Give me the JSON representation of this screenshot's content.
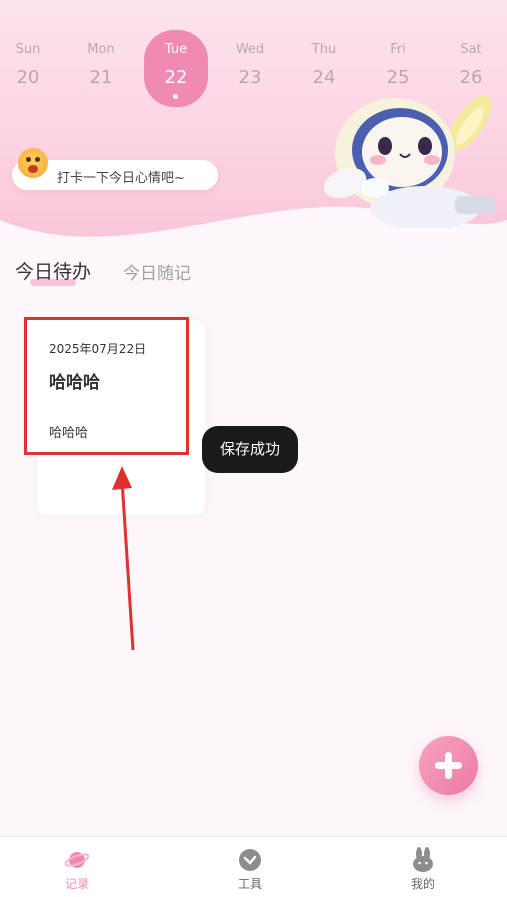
{
  "week": [
    {
      "name": "Sun",
      "num": "20"
    },
    {
      "name": "Mon",
      "num": "21"
    },
    {
      "name": "Tue",
      "num": "22",
      "selected": true
    },
    {
      "name": "Wed",
      "num": "23"
    },
    {
      "name": "Thu",
      "num": "24"
    },
    {
      "name": "Fri",
      "num": "25"
    },
    {
      "name": "Sat",
      "num": "26"
    }
  ],
  "mood_prompt": "打卡一下今日心情吧~",
  "tabs": {
    "active": "今日待办",
    "inactive": "今日随记"
  },
  "card": {
    "date": "2025年07月22日",
    "title": "哈哈哈",
    "body": "哈哈哈"
  },
  "toast": "保存成功",
  "nav": {
    "record": "记录",
    "tools": "工具",
    "mine": "我的"
  },
  "colors": {
    "accent": "#f08ab3",
    "highlight_box": "#e03131",
    "toast_bg": "#1a1a1a"
  },
  "icons": {
    "fab": "plus-icon",
    "record": "planet-icon",
    "tools": "clock-icon",
    "mine": "rabbit-icon"
  }
}
